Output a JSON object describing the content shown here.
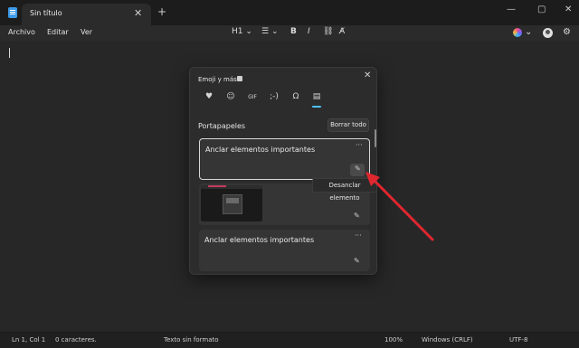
{
  "window": {
    "tab_title": "Sin título",
    "close_tab": "✕",
    "new_tab": "+",
    "controls": [
      "—",
      "▢",
      "✕"
    ]
  },
  "menu": {
    "items": [
      "Archivo",
      "Editar",
      "Ver"
    ],
    "heading": "H1",
    "bold": "B",
    "italic": "I"
  },
  "status": {
    "position": "Ln 1, Col 1",
    "chars": "0 caracteres.",
    "format": "Texto sin formato",
    "zoom": "100%",
    "eol": "Windows (CRLF)",
    "encoding": "UTF-8"
  },
  "panel": {
    "title": "Emoji y más",
    "close": "✕",
    "categories": [
      "emoji-icon",
      "smiley-icon",
      "gif-icon",
      "kaomoji-icon",
      "symbols-icon",
      "clipboard-icon"
    ],
    "section_title": "Portapapeles",
    "clear_all": "Borrar todo",
    "items": [
      {
        "text": "Anclar elementos importantes",
        "more": "···",
        "pin": "📌"
      },
      {
        "text": "",
        "more": "",
        "pin": "📌"
      },
      {
        "text": "Anclar elementos importantes",
        "more": "···",
        "pin": "📌"
      }
    ],
    "tooltip": "Desanclar elemento"
  },
  "colors": {
    "accent": "#4cc2ff",
    "arrow": "#e0262f"
  }
}
